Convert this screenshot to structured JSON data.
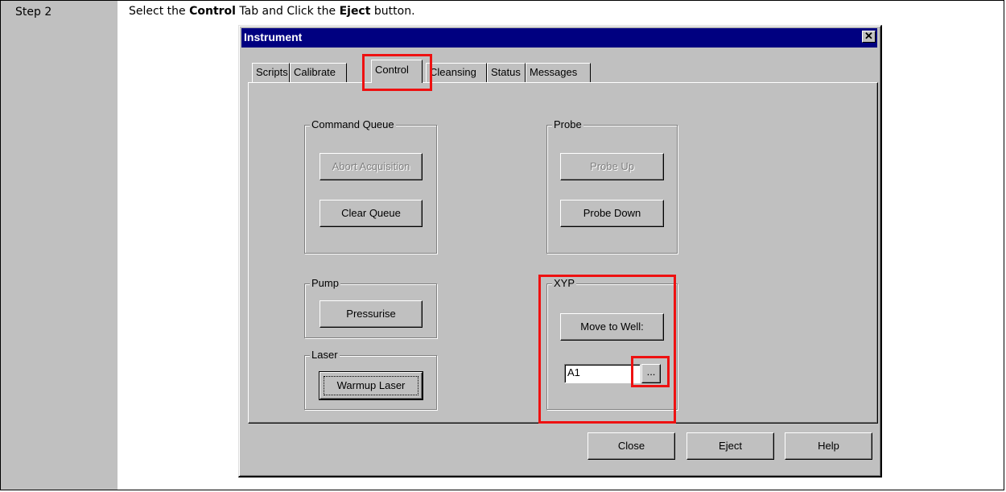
{
  "step": {
    "label": "Step 2"
  },
  "instruction": {
    "part1": "Select the ",
    "bold1": "Control",
    "part2": " Tab and Click the ",
    "bold2": "Eject",
    "part3": " button."
  },
  "dialog": {
    "title": "Instrument",
    "close_glyph": "✕",
    "tabs": [
      {
        "label": "Scripts"
      },
      {
        "label": "Calibrate"
      },
      {
        "label": "Control",
        "active": true
      },
      {
        "label": "Cleansing"
      },
      {
        "label": "Status"
      },
      {
        "label": "Messages"
      }
    ],
    "command_queue": {
      "label": "Command Queue",
      "abort_label": "Abort Acquisition",
      "clear_label": "Clear Queue"
    },
    "probe": {
      "label": "Probe",
      "up_label": "Probe Up",
      "down_label": "Probe Down"
    },
    "pump": {
      "label": "Pump",
      "pressurise_label": "Pressurise"
    },
    "laser": {
      "label": "Laser",
      "warmup_label": "Warmup Laser"
    },
    "xyp": {
      "label": "XYP",
      "move_label": "Move to Well:",
      "well_value": "A1",
      "browse_label": "..."
    },
    "footer": {
      "close_label": "Close",
      "eject_label": "Eject",
      "help_label": "Help"
    }
  },
  "colors": {
    "highlight": "#ee1111",
    "titlebar": "#000080",
    "face": "#c0c0c0"
  }
}
